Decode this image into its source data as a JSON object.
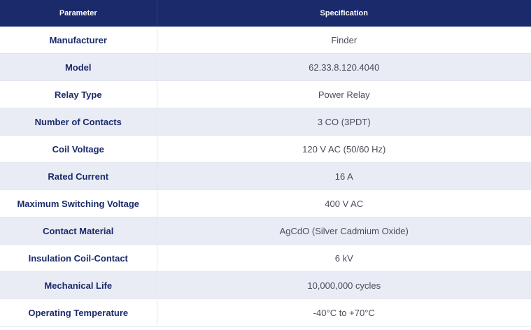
{
  "table": {
    "headers": [
      "Parameter",
      "Specification"
    ],
    "rows": [
      {
        "parameter": "Manufacturer",
        "specification": "Finder"
      },
      {
        "parameter": "Model",
        "specification": "62.33.8.120.4040"
      },
      {
        "parameter": "Relay Type",
        "specification": "Power Relay"
      },
      {
        "parameter": "Number of Contacts",
        "specification": "3 CO (3PDT)"
      },
      {
        "parameter": "Coil Voltage",
        "specification": "120 V AC (50/60 Hz)"
      },
      {
        "parameter": "Rated Current",
        "specification": "16 A"
      },
      {
        "parameter": "Maximum Switching Voltage",
        "specification": "400 V AC"
      },
      {
        "parameter": "Contact Material",
        "specification": "AgCdO (Silver Cadmium Oxide)"
      },
      {
        "parameter": "Insulation Coil-Contact",
        "specification": "6 kV"
      },
      {
        "parameter": "Mechanical Life",
        "specification": "10,000,000 cycles"
      },
      {
        "parameter": "Operating Temperature",
        "specification": "-40°C to +70°C"
      }
    ]
  },
  "colors": {
    "header_bg": "#1b2a6b",
    "stripe_bg": "#e9ecf4",
    "param_text": "#1b2a6b",
    "value_text": "#4a4e5a"
  }
}
